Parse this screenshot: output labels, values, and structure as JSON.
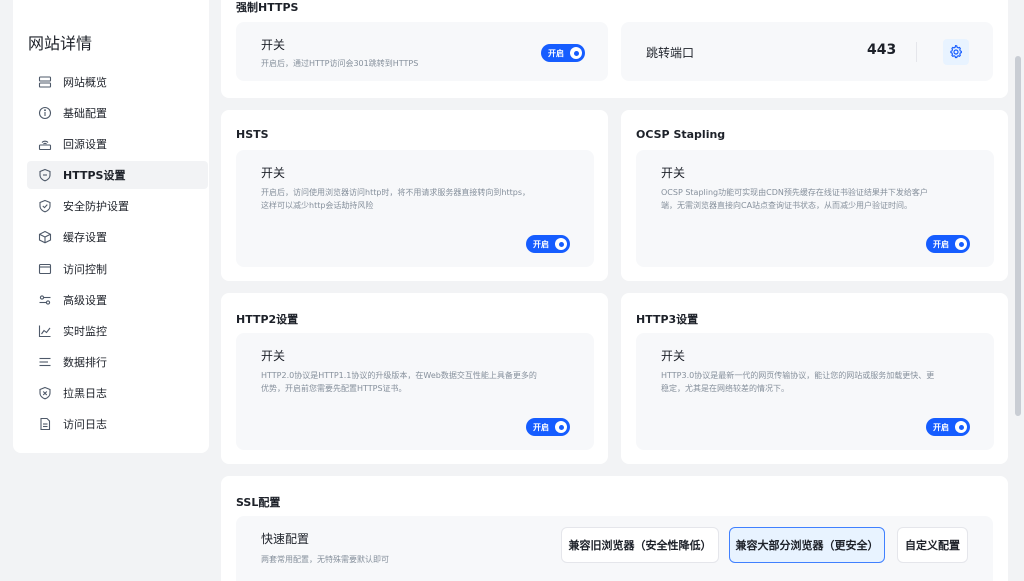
{
  "sidebar": {
    "title": "网站详情",
    "items": [
      {
        "label": "网站概览",
        "icon": "server-icon",
        "active": false
      },
      {
        "label": "基础配置",
        "icon": "info-icon",
        "active": false
      },
      {
        "label": "回源设置",
        "icon": "router-icon",
        "active": false
      },
      {
        "label": "HTTPS设置",
        "icon": "shield-icon",
        "active": true
      },
      {
        "label": "安全防护设置",
        "icon": "shield-check-icon",
        "active": false
      },
      {
        "label": "缓存设置",
        "icon": "cube-icon",
        "active": false
      },
      {
        "label": "访问控制",
        "icon": "window-icon",
        "active": false
      },
      {
        "label": "高级设置",
        "icon": "sliders-icon",
        "active": false
      },
      {
        "label": "实时监控",
        "icon": "chart-line-icon",
        "active": false
      },
      {
        "label": "数据排行",
        "icon": "list-icon",
        "active": false
      },
      {
        "label": "拉黑日志",
        "icon": "shield-x-icon",
        "active": false
      },
      {
        "label": "访问日志",
        "icon": "document-icon",
        "active": false
      }
    ]
  },
  "force_https": {
    "title": "强制HTTPS",
    "switch": {
      "title": "开关",
      "desc": "开启后，通过HTTP访问会301跳转到HTTPS",
      "toggle": "开启"
    },
    "port": {
      "label": "跳转端口",
      "value": "443",
      "icon": "gear-icon"
    }
  },
  "hsts": {
    "title": "HSTS",
    "switch_title": "开关",
    "desc": [
      "开启后，访问使用浏览器访问http时，将不用请求服务器直接转向到https，",
      "这样可以减少http会话劫持风险"
    ],
    "toggle": "开启"
  },
  "ocsp": {
    "title": "OCSP Stapling",
    "switch_title": "开关",
    "desc": [
      "OCSP Stapling功能可实现由CDN预先缓存在线证书验证结果并下发给客户",
      "端，无需浏览器直接向CA站点查询证书状态，从而减少用户验证时间。"
    ],
    "toggle": "开启"
  },
  "http2": {
    "title": "HTTP2设置",
    "switch_title": "开关",
    "desc": [
      "HTTP2.0协议是HTTP1.1协议的升级版本，在Web数据交互性能上具备更多的",
      "优势，开启前您需要先配置HTTPS证书。"
    ],
    "toggle": "开启"
  },
  "http3": {
    "title": "HTTP3设置",
    "switch_title": "开关",
    "desc": [
      "HTTP3.0协议是最新一代的网页传输协议，能让您的网站或服务加载更快、更",
      "稳定，尤其是在网络较差的情况下。"
    ],
    "toggle": "开启"
  },
  "ssl": {
    "title": "SSL配置",
    "quick_title": "快速配置",
    "quick_desc": "两套常用配置，无特殊需要默认即可",
    "buttons": [
      "兼容旧浏览器（安全性降低）",
      "兼容大部分浏览器（更安全）",
      "自定义配置"
    ],
    "selected_index": 1
  },
  "colors": {
    "accent": "#165dff",
    "selected_bg": "#e8f3ff",
    "page_bg": "#f2f3f5"
  }
}
